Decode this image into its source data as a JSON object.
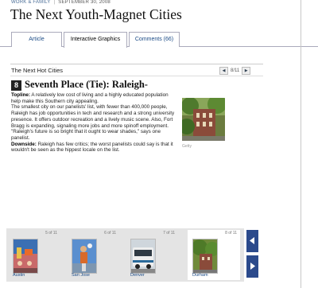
{
  "header": {
    "section": "WORK & FAMILY",
    "date": "SEPTEMBER 30, 2008",
    "title": "The Next Youth-Magnet Cities"
  },
  "tabs": [
    {
      "label": "Article",
      "active": false
    },
    {
      "label": "Interactive Graphics",
      "active": true
    },
    {
      "label": "Comments (66)",
      "active": false
    }
  ],
  "graphic": {
    "section_title": "The Next Hot Cities",
    "pager": "8/11",
    "rank": "8",
    "heading": "Seventh Place (Tie): Raleigh-",
    "topline_label": "Topline:",
    "topline_text": " A relatively low cost of living and a highly educated population help make this Southern city appealing.",
    "paragraph": "The smallest city on our panelists' list, with fewer than 400,000 people, Raleigh has job opportunities in tech and research and a strong university presence. It offers outdoor recreation and a lively music scene. Also, Fort Bragg is expanding, signaling more jobs and more spinoff employment. \"Raleigh's future is so bright that it ought to wear shades,\" says one panelist.",
    "downside_label": "Downside:",
    "downside_text": " Raleigh has few critics; the worst panelists could say is that it wouldn't be seen as the hippest locale on the list.",
    "photo_credit": "Getty"
  },
  "thumbnails": [
    {
      "count": "5 of 11",
      "name": "Austin",
      "selected": false
    },
    {
      "count": "6 of 11",
      "name": "San Jose",
      "selected": false
    },
    {
      "count": "7 of 11",
      "name": "Denver",
      "selected": false
    },
    {
      "count": "8 of 11",
      "name": "Durham",
      "selected": true
    }
  ],
  "colors": {
    "nav": "#2b4a8c",
    "link": "#1a4a86"
  }
}
